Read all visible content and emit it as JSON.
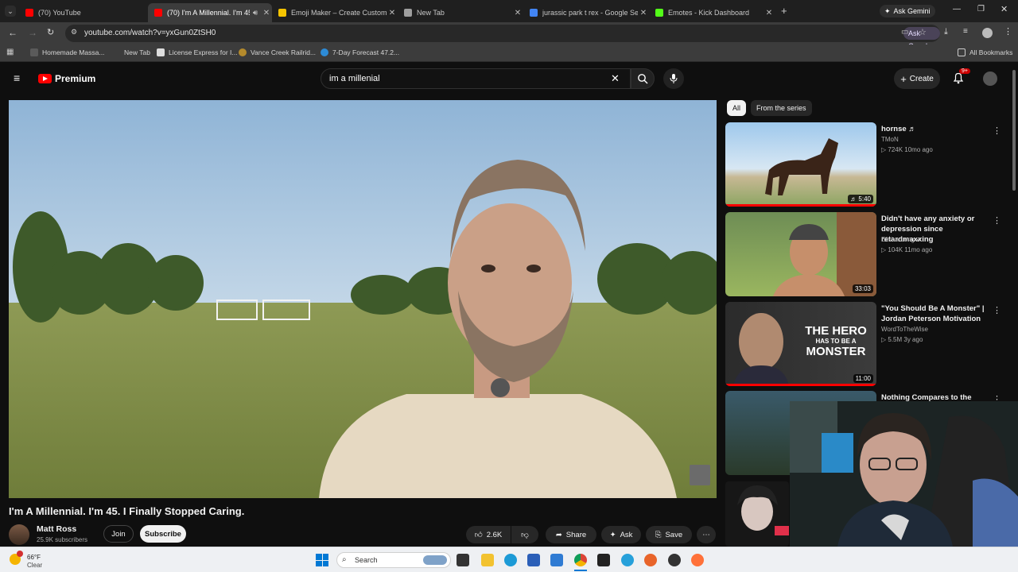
{
  "browser": {
    "tabs": [
      {
        "title": "(70) YouTube",
        "active": false,
        "color": "#ff0000"
      },
      {
        "title": "(70) I'm A Millennial. I'm 45",
        "active": true,
        "color": "#ff0000"
      },
      {
        "title": "Emoji Maker – Create Custom",
        "active": false,
        "color": "#f5c400"
      },
      {
        "title": "New Tab",
        "active": false,
        "color": "#9e9e9e"
      },
      {
        "title": "jurassic park t rex - Google Sea",
        "active": false,
        "color": "#4285f4"
      },
      {
        "title": "Emotes - Kick Dashboard",
        "active": false,
        "color": "#53fc18"
      }
    ],
    "ask_gemini": "Ask Gemini",
    "url": "youtube.com/watch?v=yxGun0ZtSH0",
    "ask_google": "Ask Google",
    "bookmarks": [
      "Homemade Massa...",
      "New Tab",
      "License Express for I...",
      "Vance Creek Railrid...",
      "7-Day Forecast 47.2..."
    ],
    "all_bookmarks": "All Bookmarks"
  },
  "youtube": {
    "logo_text": "Premium",
    "search_query": "im a millenial",
    "create_label": "Create",
    "notif_badge": "9+",
    "video": {
      "title": "I'm A Millennial. I'm 45. I Finally Stopped Caring.",
      "channel": "Matt Ross",
      "subscribers": "25.9K subscribers",
      "join": "Join",
      "subscribe": "Subscribe",
      "likes": "2.6K",
      "share": "Share",
      "ask": "Ask",
      "save": "Save"
    },
    "chips": [
      "All",
      "From the series"
    ],
    "recommendations": [
      {
        "title": "hornse ♬",
        "channel": "TMoN",
        "meta": "▷ 724K  10mo ago",
        "duration": "♬ 5:40",
        "watched": 1.0
      },
      {
        "title": "Didn't have any anxiety or depression since retardmaxxing",
        "channel": "Elisha Long",
        "meta": "▷ 104K  11mo ago",
        "duration": "33:03",
        "watched": 0.0
      },
      {
        "title": "\"You Should Be A Monster\" | Jordan Peterson Motivation",
        "channel": "WordToTheWise",
        "meta": "▷ 5.5M  3y ago",
        "duration": "11:00",
        "watched": 1.0,
        "thumb_text": [
          "THE HERO",
          "HAS TO BE A",
          "MONSTER"
        ]
      },
      {
        "title": "Nothing Compares to the",
        "channel": "",
        "meta": "",
        "duration": "",
        "watched": 0.0
      }
    ]
  },
  "taskbar": {
    "weather_temp": "66°F",
    "weather_desc": "Clear",
    "search_placeholder": "Search"
  }
}
